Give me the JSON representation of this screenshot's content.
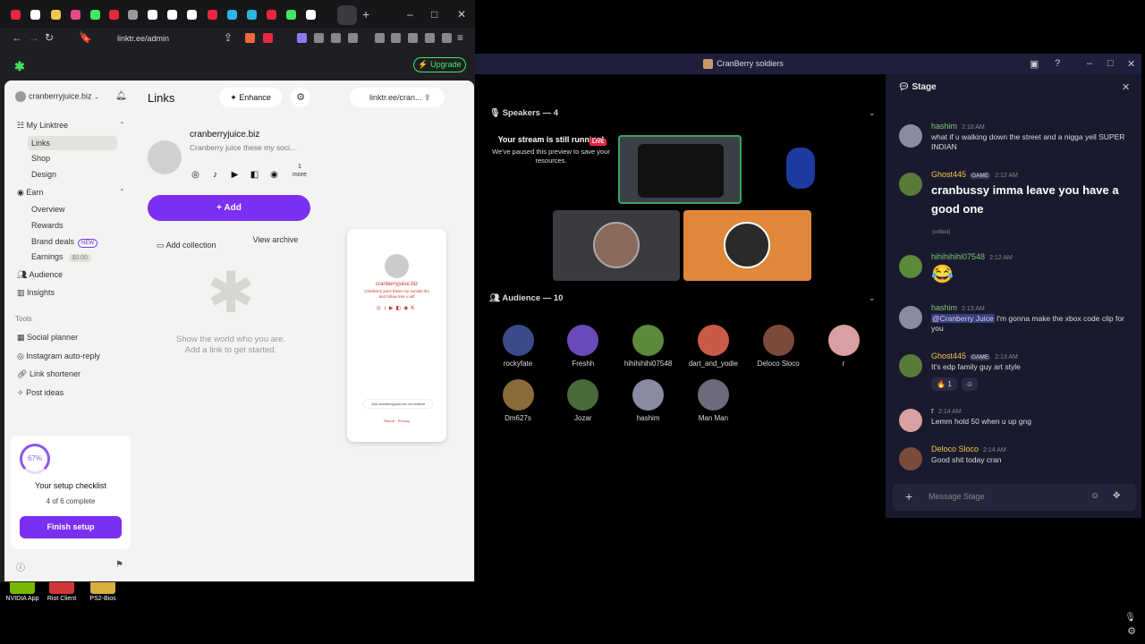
{
  "desktop": {
    "icons": [
      {
        "label": "NVIDIA App",
        "color": "#76b900"
      },
      {
        "label": "Riot Client",
        "color": "#d13639"
      },
      {
        "label": "PS2-Bios",
        "color": "#d8b040"
      }
    ]
  },
  "browser": {
    "tabs_favicon_colors": [
      "#e8273f",
      "#ffffff",
      "#f0c84a",
      "#e64a8a",
      "#43e660",
      "#e8273f",
      "#999999",
      "#ffffff",
      "#ffffff",
      "#ffffff",
      "#e8273f",
      "#2bb5e0",
      "#2bb5e0",
      "#e8273f",
      "#43e660",
      "#ffffff"
    ],
    "url": "linktr.ee/admin",
    "new_tab": "+",
    "window_controls": [
      "–",
      "□",
      "✕"
    ]
  },
  "linktree": {
    "upgrade_label": "Upgrade",
    "account": "cranberryjuice.biz",
    "my_linktree": "My Linktree",
    "nav": {
      "links": "Links",
      "shop": "Shop",
      "design": "Design",
      "earn": "Earn",
      "overview": "Overview",
      "rewards": "Rewards",
      "brand_deals": "Brand deals",
      "new_badge": "NEW",
      "earnings": "Earnings",
      "earnings_amount": "$0.00",
      "audience": "Audience",
      "insights": "Insights"
    },
    "tools_label": "Tools",
    "tools": {
      "social_planner": "Social planner",
      "instagram_auto_reply": "Instagram auto-reply",
      "link_shortener": "Link shortener",
      "post_ideas": "Post ideas"
    },
    "setup": {
      "percent": "67%",
      "title": "Your setup checklist",
      "progress": "4 of 6 complete",
      "button": "Finish setup"
    },
    "main": {
      "title": "Links",
      "enhance": "Enhance",
      "profile_name": "cranberryjuice.biz",
      "profile_bio": "Cranberry juice these my soci...",
      "more_count": "1",
      "more_label": "more",
      "add_label": "Add",
      "add_collection": "Add collection",
      "view_archive": "View archive",
      "empty_line1": "Show the world who you are.",
      "empty_line2": "Add a link to get started."
    },
    "preview": {
      "share_url": "linktr.ee/cran...",
      "name": "cranberryjuice.biz",
      "bio": "Cranberry juice these my socials tho and follow tree u wtf",
      "join": "Join cranberryjuice.biz on Linktree",
      "footer": "Report · Privacy"
    }
  },
  "discord": {
    "window_title": "CranBerry soldiers",
    "speakers_header": "Speakers — 4",
    "stream_title": "Your stream is still running!",
    "stream_sub": "We've paused this preview to save your resources.",
    "live": "LIVE",
    "audience_header": "Audience — 10",
    "audience": [
      {
        "name": "rockyfate",
        "color": "#3a4a8a"
      },
      {
        "name": "Freshh",
        "color": "#6a4ab8"
      },
      {
        "name": "hihihihihi07548",
        "color": "#5a8a3a"
      },
      {
        "name": "dart_and_yodie",
        "color": "#c95a4a"
      },
      {
        "name": "Deloco Sloco",
        "color": "#7a4a3a"
      },
      {
        "name": "r",
        "color": "#d8a0a0"
      },
      {
        "name": "Dm627s",
        "color": "#8a6a3a"
      },
      {
        "name": "Jozar",
        "color": "#4a6a3a"
      },
      {
        "name": "hashim",
        "color": "#8a8aa0"
      },
      {
        "name": "Man Man",
        "color": "#6a6a7a"
      }
    ],
    "chat": {
      "title": "Stage",
      "messages": [
        {
          "user": "hashim",
          "time": "2:10 AM",
          "text": "what if u walking down the street and a nigga yell SUPER INDIAN"
        },
        {
          "user": "Ghost445",
          "tag": "GAME",
          "time": "2:12 AM",
          "text": "cranbussy imma leave you have a good one",
          "edited": "(edited)"
        },
        {
          "user": "hihihihihi07548",
          "time": "2:12 AM",
          "text": "😂"
        },
        {
          "user": "hashim",
          "time": "2:13 AM",
          "mention": "@Cranberry Juice",
          "text": " I'm gonna make the xbox code clip for you"
        },
        {
          "user": "Ghost445",
          "tag": "GAME",
          "time": "2:13 AM",
          "text": "It's edp family guy art style",
          "reaction": "🔥 1"
        },
        {
          "user": "r",
          "time": "2:14 AM",
          "text": "Lemm hold 50 when u up gng"
        },
        {
          "user": "Deloco Sloco",
          "time": "2:14 AM",
          "text": "Good shit today cran"
        }
      ],
      "input_placeholder": "Message Stage"
    }
  }
}
